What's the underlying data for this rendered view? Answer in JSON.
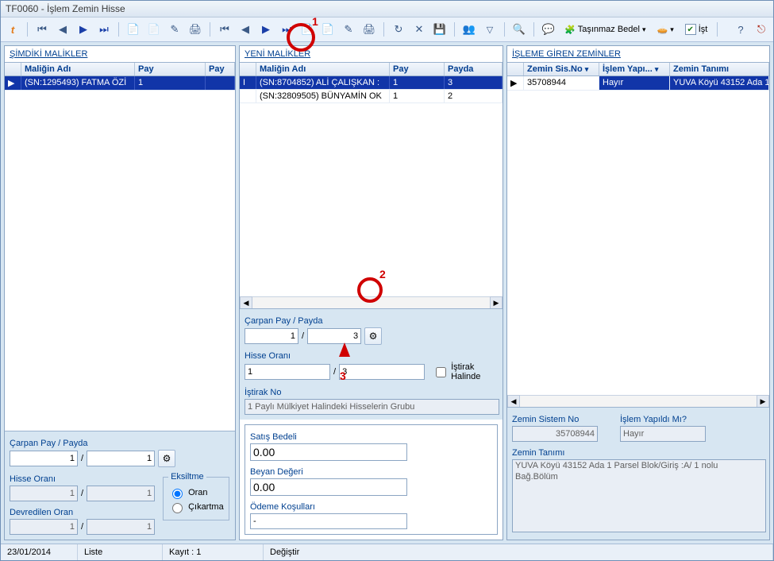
{
  "window": {
    "title": "TF0060 - İşlem Zemin Hisse"
  },
  "toolbar": {
    "tasinmaz_bedel": "Taşınmaz Bedel",
    "ist": "İşt"
  },
  "left": {
    "title": "ŞİMDİKİ MALİKLER",
    "cols": {
      "malik": "Maliğin Adı",
      "pay": "Pay",
      "payda": "Pay"
    },
    "rows": [
      {
        "malik": "(SN:1295493) FATMA ÖZİ",
        "pay": "1",
        "payda": ""
      }
    ],
    "form": {
      "carpan_label": "Çarpan Pay / Payda",
      "carpan_pay": "1",
      "carpan_payda": "1",
      "hisse_label": "Hisse Oranı",
      "hisse_pay": "1",
      "hisse_payda": "1",
      "devredilen_label": "Devredilen Oran",
      "dev_pay": "1",
      "dev_payda": "1",
      "eksiltme_legend": "Eksiltme",
      "radio_oran": "Oran",
      "radio_cikartma": "Çıkartma"
    }
  },
  "mid": {
    "title": "YENİ MALİKLER",
    "cols": {
      "malik": "Maliğin Adı",
      "pay": "Pay",
      "payda": "Payda"
    },
    "rows": [
      {
        "malik": "(SN:8704852) ALİ ÇALIŞKAN :",
        "pay": "1",
        "payda": "3"
      },
      {
        "malik": "(SN:32809505) BÜNYAMİN OK",
        "pay": "1",
        "payda": "2"
      }
    ],
    "form": {
      "carpan_label": "Çarpan Pay / Payda",
      "carpan_pay": "1",
      "carpan_payda": "3",
      "hisse_label": "Hisse Oranı",
      "hisse_pay": "1",
      "hisse_payda": "3",
      "istirak_label": "İştirak Halinde",
      "istirak_no_label": "İştirak No",
      "istirak_no_val": "1 Paylı Mülkiyet Halindeki Hisselerin Grubu",
      "satis_label": "Satış Bedeli",
      "satis_val": "0.00",
      "beyan_label": "Beyan Değeri",
      "beyan_val": "0.00",
      "odeme_label": "Ödeme Koşulları",
      "odeme_val": "-"
    }
  },
  "right": {
    "title": "İŞLEME GİREN ZEMİNLER",
    "cols": {
      "sis": "Zemin Sis.No",
      "islem": "İşlem Yapı...",
      "tanim": "Zemin Tanımı"
    },
    "rows": [
      {
        "sis": "35708944",
        "islem": "Hayır",
        "tanim": "YUVA Köyü 43152 Ada 1"
      }
    ],
    "form": {
      "sis_label": "Zemin Sistem No",
      "sis_val": "35708944",
      "islem_label": "İşlem Yapıldı Mı?",
      "islem_val": "Hayır",
      "tanim_label": "Zemin Tanımı",
      "tanim_val": "YUVA Köyü 43152 Ada 1 Parsel Blok/Giriş :A/ 1 nolu Bağ.Bölüm"
    }
  },
  "status": {
    "date": "23/01/2014",
    "liste": "Liste",
    "kayit": "Kayıt : 1",
    "mode": "Değiştir"
  },
  "annotations": {
    "n1": "1",
    "n2": "2",
    "n3": "3"
  }
}
